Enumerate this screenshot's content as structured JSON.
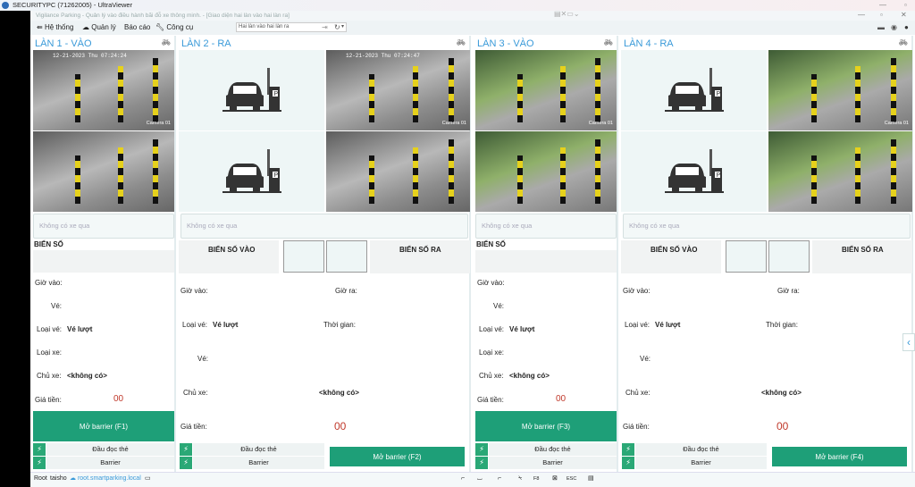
{
  "window": {
    "title": "SECURITYPC (71262005) - UltraViewer",
    "app_title": "Vigilance Parking - Quản lý vào điều hành bãi đỗ xe thông minh. - [Giao diện hai làn vào hai làn ra]"
  },
  "menu": {
    "items": [
      "Hệ thống",
      "Quản lý",
      "Báo cáo",
      "Công cụ"
    ],
    "layout_select": "Hai làn vào hai làn ra"
  },
  "colors": {
    "accent": "#1e9f78",
    "title": "#3a9ad9",
    "price": "#c0392b"
  },
  "lanes": [
    {
      "title": "LÀN 1 - VÀO",
      "type": "in",
      "cam1_time": "12-21-2023 Thu 07:24:24",
      "cam_label": "Camera 01",
      "plate_placeholder": "Không có xe qua",
      "plate_label": "BIỂN SỐ",
      "gio_vao": "Giờ vào:",
      "ve": "Vé:",
      "loai_ve": "Loại vé:",
      "loai_ve_value": "Vé lượt",
      "loai_xe": "Loại xe:",
      "chu_xe": "Chủ xe:",
      "chu_xe_value": "<không có>",
      "gia_tien": "Giá tiền:",
      "gia_tien_value": "00",
      "open_button": "Mở barrier (F1)",
      "reader": "Đầu đọc thẻ",
      "barrier": "Barrier"
    },
    {
      "title": "LÀN 2 - RA",
      "type": "out",
      "cam1_time": "12-21-2023 Thu 07:24:47",
      "cam_label": "Camera 01",
      "plate_placeholder": "Không có xe qua",
      "plate_in_label": "BIỂN SỐ VÀO",
      "plate_out_label": "BIỂN SỐ RA",
      "gio_vao": "Giờ vào:",
      "gio_ra": "Giờ ra:",
      "loai_ve": "Loại vé:",
      "loai_ve_value": "Vé lượt",
      "thoi_gian": "Thời gian:",
      "ve": "Vé:",
      "chu_xe": "Chủ xe:",
      "chu_xe_value": "<không có>",
      "gia_tien": "Giá tiền:",
      "gia_tien_value": "00",
      "open_button": "Mở barrier (F2)",
      "reader": "Đầu đọc thẻ",
      "barrier": "Barrier"
    },
    {
      "title": "LÀN 3 - VÀO",
      "type": "in",
      "cam1_time": "",
      "cam_label": "Camera 01",
      "plate_placeholder": "Không có xe qua",
      "plate_label": "BIỂN SỐ",
      "gio_vao": "Giờ vào:",
      "ve": "Vé:",
      "loai_ve": "Loại vé:",
      "loai_ve_value": "Vé lượt",
      "loai_xe": "Loại xe:",
      "chu_xe": "Chủ xe:",
      "chu_xe_value": "<không có>",
      "gia_tien": "Giá tiền:",
      "gia_tien_value": "00",
      "open_button": "Mở barrier (F3)",
      "reader": "Đầu đọc thẻ",
      "barrier": "Barrier"
    },
    {
      "title": "LÀN 4 - RA",
      "type": "out",
      "cam1_time": "",
      "cam_label": "Camera 01",
      "plate_placeholder": "Không có xe qua",
      "plate_in_label": "BIỂN SỐ VÀO",
      "plate_out_label": "BIỂN SỐ RA",
      "gio_vao": "Giờ vào:",
      "gio_ra": "Giờ ra:",
      "loai_ve": "Loại vé:",
      "loai_ve_value": "Vé lượt",
      "thoi_gian": "Thời gian:",
      "ve": "Vé:",
      "chu_xe": "Chủ xe:",
      "chu_xe_value": "<không có>",
      "gia_tien": "Giá tiền:",
      "gia_tien_value": "00",
      "open_button": "Mở barrier (F4)",
      "reader": "Đầu đọc thẻ",
      "barrier": "Barrier"
    }
  ],
  "status": {
    "user": "Root",
    "name": "taisho",
    "server": "root.smartparking.local",
    "key_f8": "F8",
    "key_esc": "ESC"
  }
}
